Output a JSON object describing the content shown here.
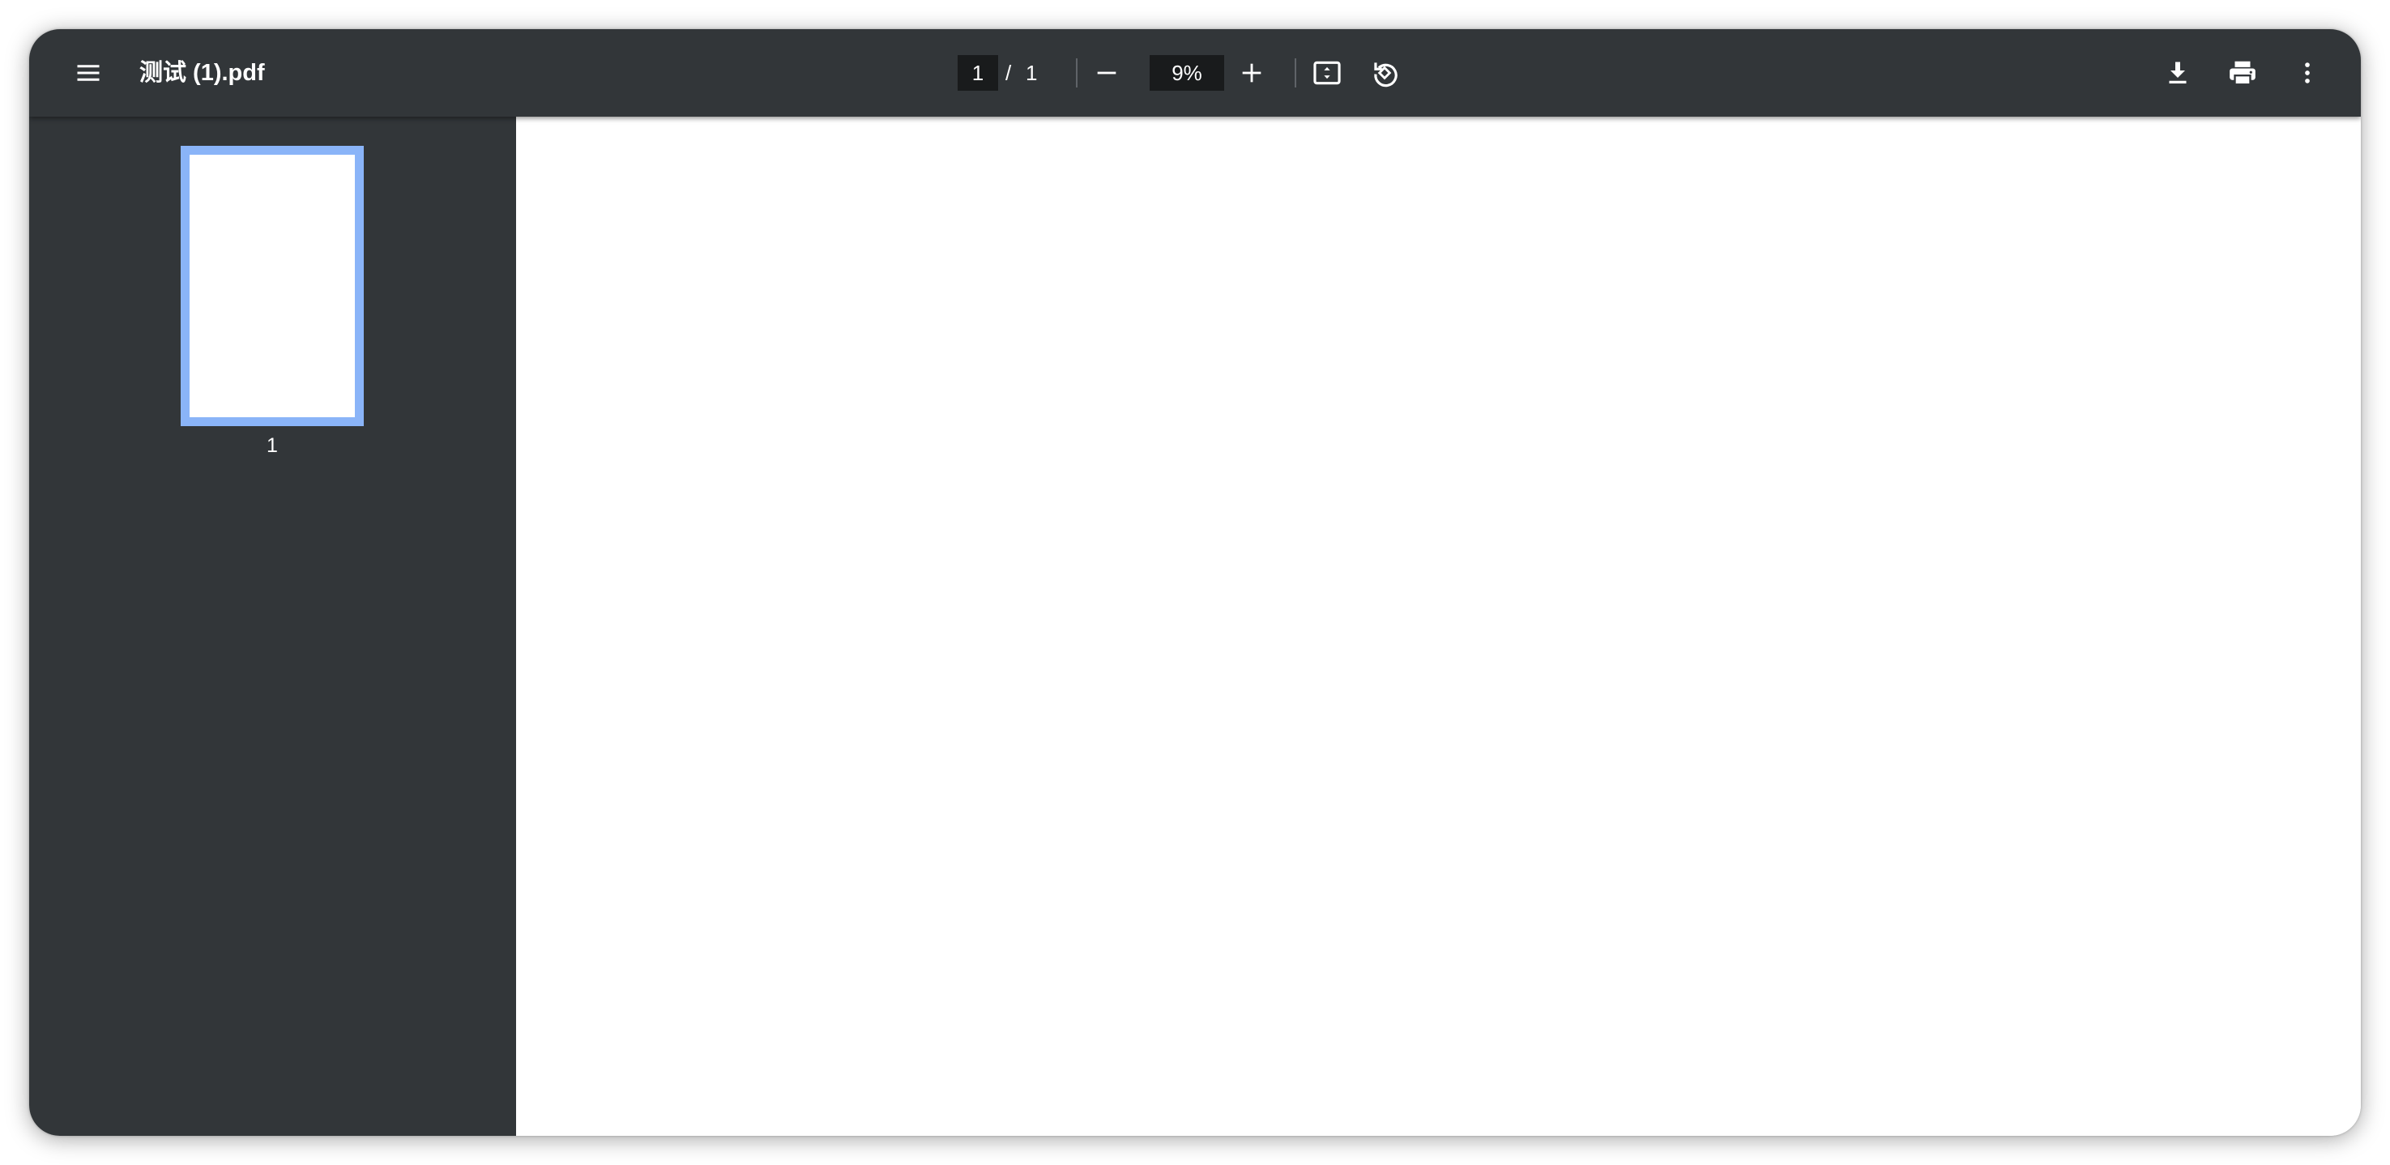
{
  "toolbar": {
    "menu_icon": "menu-icon",
    "title": "测试 (1).pdf",
    "page_current": "1",
    "page_separator": "/",
    "page_total": "1",
    "zoom_out_icon": "minus-icon",
    "zoom_value": "9%",
    "zoom_in_icon": "plus-icon",
    "fit_icon": "fit-to-page-icon",
    "rotate_icon": "rotate-icon",
    "download_icon": "download-icon",
    "print_icon": "print-icon",
    "more_icon": "more-vertical-icon"
  },
  "sidebar": {
    "thumbnails": [
      {
        "label": "1"
      }
    ]
  },
  "colors": {
    "toolbar_bg": "#323639",
    "sidebar_bg": "#323639",
    "thumbnail_selected_border": "#8ab4f8",
    "page_bg": "#ffffff"
  }
}
